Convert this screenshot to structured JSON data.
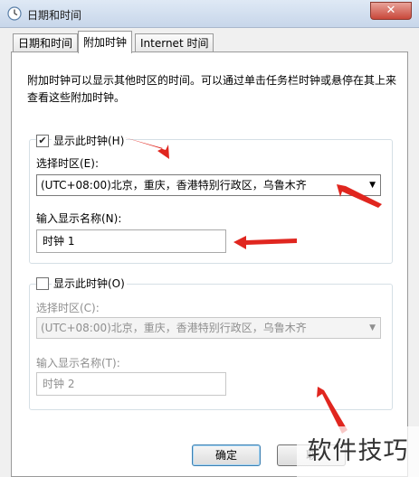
{
  "window": {
    "title": "日期和时间",
    "close_symbol": "✕"
  },
  "tabs": [
    {
      "label": "日期和时间",
      "active": false
    },
    {
      "label": "附加时钟",
      "active": true
    },
    {
      "label": "Internet 时间",
      "active": false
    }
  ],
  "description": "附加时钟可以显示其他时区的时间。可以通过单击任务栏时钟或悬停在其上来查看这些附加时钟。",
  "clock1": {
    "show_label": "显示此时钟(H)",
    "checked": true,
    "timezone_label": "选择时区(E):",
    "timezone_value": "(UTC+08:00)北京，重庆，香港特别行政区，乌鲁木齐",
    "name_label": "输入显示名称(N):",
    "name_value": "时钟 1"
  },
  "clock2": {
    "show_label": "显示此时钟(O)",
    "checked": false,
    "timezone_label": "选择时区(C):",
    "timezone_value": "(UTC+08:00)北京，重庆，香港特别行政区，乌鲁木齐",
    "name_label": "输入显示名称(T):",
    "name_value": "时钟 2"
  },
  "buttons": {
    "ok": "确定",
    "cancel": "取"
  },
  "watermark": "软件技巧",
  "colors": {
    "annotation_red": "#e0261f",
    "accent_blue": "#3c7fb1"
  }
}
